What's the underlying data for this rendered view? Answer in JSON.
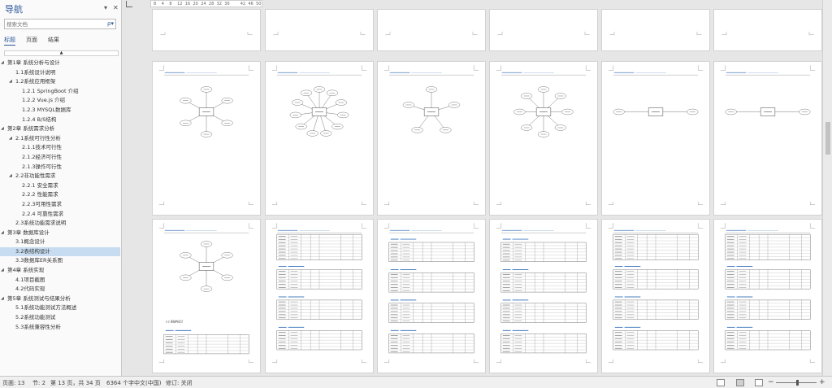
{
  "nav": {
    "title": "导航",
    "menu_glyph": "▾",
    "close_glyph": "✕",
    "search_placeholder": "搜索文档",
    "search_icon_glyph": "ρ▾",
    "tabs": [
      "标题",
      "页面",
      "结果"
    ],
    "collapse_glyph": "▲",
    "headings": [
      {
        "level": 1,
        "text": "第1章 系统分析与设计",
        "expanded": true
      },
      {
        "level": 2,
        "text": "1.1系统设计说明"
      },
      {
        "level": 2,
        "text": "1.2系统应用框架",
        "expanded": true
      },
      {
        "level": 3,
        "text": "1.2.1 SpringBoot 介绍"
      },
      {
        "level": 3,
        "text": "1.2.2 Vue.js 介绍"
      },
      {
        "level": 3,
        "text": "1.2.3 MYSQL数据库"
      },
      {
        "level": 3,
        "text": "1.2.4 B/S结构"
      },
      {
        "level": 1,
        "text": "第2章 系统需求分析",
        "expanded": true
      },
      {
        "level": 2,
        "text": "2.1系统可行性分析",
        "expanded": true
      },
      {
        "level": 3,
        "text": "2.1.1技术可行性"
      },
      {
        "level": 3,
        "text": "2.1.2经济可行性"
      },
      {
        "level": 3,
        "text": "2.1.3操作可行性"
      },
      {
        "level": 2,
        "text": "2.2非功能性需求",
        "expanded": true
      },
      {
        "level": 3,
        "text": "2.2.1 安全需求"
      },
      {
        "level": 3,
        "text": "2.2.2 性能需求"
      },
      {
        "level": 3,
        "text": "2.2.3可用性需求"
      },
      {
        "level": 3,
        "text": "2.2.4 可靠性需求"
      },
      {
        "level": 2,
        "text": "2.3系统功能需求说明"
      },
      {
        "level": 1,
        "text": "第3章 数据库设计",
        "expanded": true
      },
      {
        "level": 2,
        "text": "3.1概念设计"
      },
      {
        "level": 2,
        "text": "3.2表结构设计",
        "selected": true
      },
      {
        "level": 2,
        "text": "3.3数据库ER关系图"
      },
      {
        "level": 1,
        "text": "第4章 系统实现",
        "expanded": true
      },
      {
        "level": 2,
        "text": "4.1项目截图"
      },
      {
        "level": 2,
        "text": "4.2代码实现"
      },
      {
        "level": 1,
        "text": "第5章 系统测试与结果分析",
        "expanded": true
      },
      {
        "level": 2,
        "text": "5.1系统功能测试方法概述"
      },
      {
        "level": 2,
        "text": "5.2系统功能测试"
      },
      {
        "level": 2,
        "text": "5.3系统兼容性分析"
      }
    ]
  },
  "ruler": {
    "ticks": [
      "8",
      "4",
      "8",
      "12",
      "16",
      "20",
      "24",
      "28",
      "32",
      "36",
      "",
      "42",
      "46",
      "50"
    ]
  },
  "document": {
    "page3_caption": "3.2 表结构设计"
  },
  "status": {
    "page": "页面: 13",
    "section": "节: 2",
    "page_of": "第 13 页，共 34 页",
    "word_count": "6364 个字",
    "language": "中文(中国)",
    "track_changes": "修订: 关闭",
    "zoom_minus": "−",
    "zoom_plus": "+"
  }
}
